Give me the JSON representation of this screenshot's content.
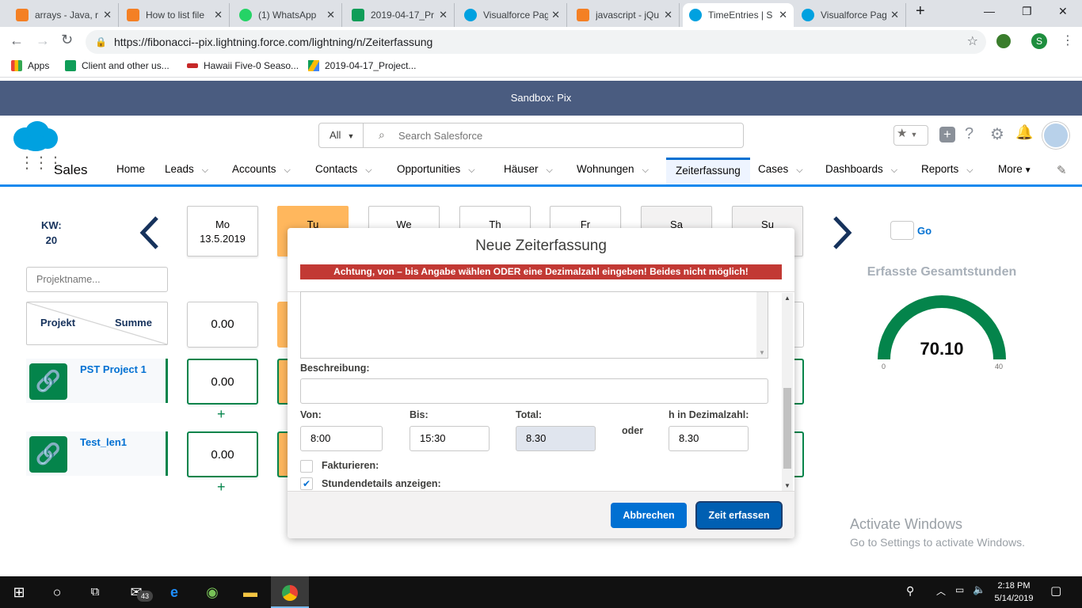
{
  "browser": {
    "tabs": [
      {
        "title": "arrays - Java, r",
        "color": "#f48024"
      },
      {
        "title": "How to list file",
        "color": "#f48024"
      },
      {
        "title": "(1) WhatsApp",
        "color": "#25d366"
      },
      {
        "title": "2019-04-17_Pr",
        "color": "#0f9d58"
      },
      {
        "title": "Visualforce Pag",
        "color": "#00a1e0"
      },
      {
        "title": "javascript - jQu",
        "color": "#f48024"
      },
      {
        "title": "TimeEntries | S",
        "color": "#00a1e0"
      },
      {
        "title": "Visualforce Pag",
        "color": "#00a1e0"
      }
    ],
    "url": "https://fibonacci--pix.lightning.force.com/lightning/n/Zeiterfassung",
    "profile_letter": "S",
    "bookmarks": [
      "Apps",
      "Client and other us...",
      "Hawaii Five-0 Seaso...",
      "2019-04-17_Project..."
    ]
  },
  "sandbox_label": "Sandbox: Pix",
  "search": {
    "scope": "All",
    "placeholder": "Search Salesforce"
  },
  "nav": {
    "app_name": "Sales",
    "items": [
      "Home",
      "Leads",
      "Accounts",
      "Contacts",
      "Opportunities",
      "Häuser",
      "Wohnungen",
      "Zeiterfassung",
      "Cases",
      "Dashboards",
      "Reports",
      "More"
    ]
  },
  "week": {
    "kw_label": "KW:",
    "kw_number": "20",
    "days": [
      {
        "name": "Mo",
        "date": "13.5.2019"
      },
      {
        "name": "Tu",
        "date": ""
      },
      {
        "name": "We",
        "date": ""
      },
      {
        "name": "Th",
        "date": ""
      },
      {
        "name": "Fr",
        "date": ""
      },
      {
        "name": "Sa",
        "date": ""
      },
      {
        "name": "Su",
        "date": ""
      }
    ],
    "go_label": "Go"
  },
  "projects": {
    "filter_placeholder": "Projektname...",
    "header_project": "Projekt",
    "header_sum": "Summe",
    "total_mo": "0.00",
    "rows": [
      {
        "name": "PST Project 1",
        "mo_value": "0.00"
      },
      {
        "name": "Test_len1",
        "mo_value": "0.00"
      }
    ]
  },
  "gauge": {
    "title": "Erfasste Gesamtstunden",
    "value": "70.10",
    "value_num": 70.1,
    "min": "0",
    "max": "40",
    "color": "#04844b"
  },
  "modal": {
    "title": "Neue Zeiterfassung",
    "warning": "Achtung, von – bis Angabe wählen ODER eine Dezimalzahl eingeben! Beides nicht möglich!",
    "beschreibung_label": "Beschreibung:",
    "von_label": "Von:",
    "von_value": "8:00",
    "bis_label": "Bis:",
    "bis_value": "15:30",
    "total_label": "Total:",
    "total_value": "8.30",
    "oder_label": "oder",
    "dezimal_label": "h in Dezimalzahl:",
    "dezimal_value": "8.30",
    "fakturieren_label": "Fakturieren:",
    "stundendetails_label": "Stundendetails anzeigen:",
    "cancel_label": "Abbrechen",
    "submit_label": "Zeit erfassen"
  },
  "watermark": {
    "title": "Activate Windows",
    "subtitle": "Go to Settings to activate Windows."
  },
  "taskbar": {
    "time": "2:18 PM",
    "date": "5/14/2019",
    "mail_badge": "43"
  }
}
